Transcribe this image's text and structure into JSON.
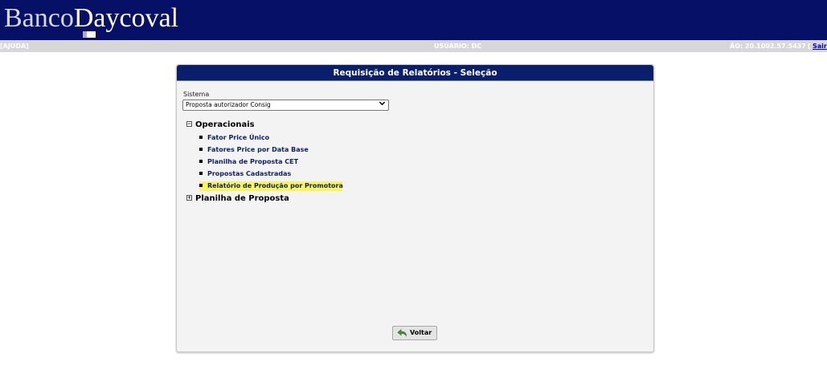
{
  "header": {
    "logo_part1": "Banco",
    "logo_part2": "Daycoval"
  },
  "statusbar": {
    "help": "[AJUDA]",
    "user": "USUÁRIO: DC",
    "version": "ÃO: 20.1002.57.5437",
    "bracket": "[",
    "logout": "Sair"
  },
  "panel": {
    "title": "Requisição de Relatórios - Seleção",
    "system_label": "Sistema",
    "system_value": "Proposta autorizador Consig",
    "groups": [
      {
        "label": "Operacionais",
        "expanded": true,
        "items": [
          "Fator Price Único",
          "Fatores Price por Data Base",
          "Planilha de Proposta CET",
          "Propostas Cadastradas",
          "Relatório de Produção por Promotora"
        ],
        "highlighted_index": 4
      },
      {
        "label": "Planilha de Proposta",
        "expanded": false,
        "items": []
      }
    ],
    "back_button": "Voltar"
  },
  "colors": {
    "header_bg": "#051066",
    "title_bg": "#0a1f6b",
    "highlight": "#fbf55b",
    "statusbar_bg": "#d7d7d7"
  },
  "icons": {
    "expanded": "minus-box-icon",
    "collapsed": "plus-box-icon",
    "item": "square-bullet-icon",
    "back": "back-arrow-icon"
  }
}
